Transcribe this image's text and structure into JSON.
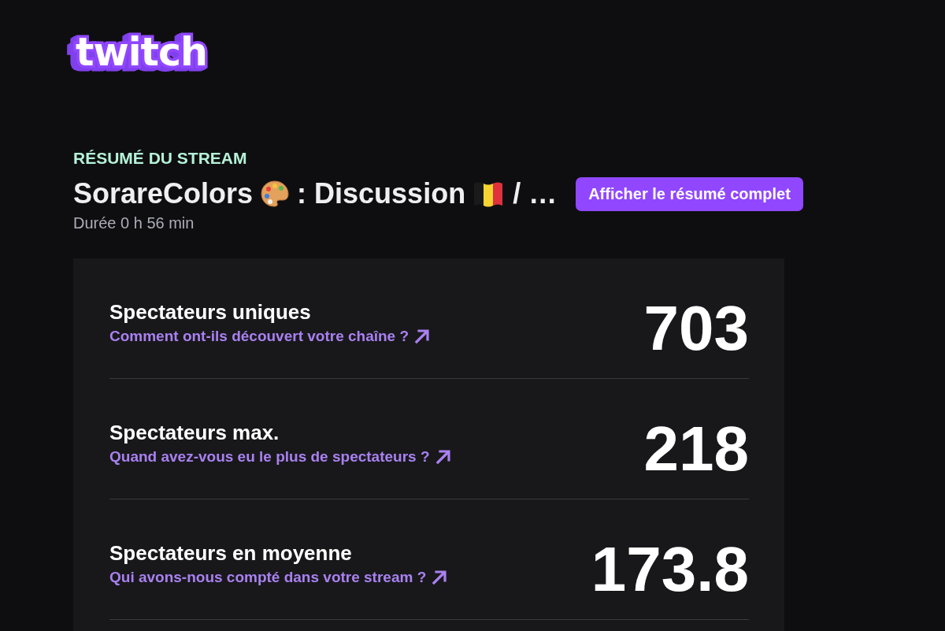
{
  "logo": {
    "text": "twitch"
  },
  "summary": {
    "eyebrow": "RÉSUMÉ DU STREAM",
    "title_parts": [
      "SorareColors",
      ": Discussion",
      "/ …"
    ],
    "full_summary_button": "Afficher le résumé complet",
    "duration": "Durée 0 h 56 min"
  },
  "stats": [
    {
      "label": "Spectateurs uniques",
      "link": "Comment ont-ils découvert votre chaîne ?",
      "value": "703"
    },
    {
      "label": "Spectateurs max.",
      "link": "Quand avez-vous eu le plus de spectateurs ?",
      "value": "218"
    },
    {
      "label": "Spectateurs en moyenne",
      "link": "Qui avons-nous compté dans votre stream ?",
      "value": "173.8"
    }
  ]
}
